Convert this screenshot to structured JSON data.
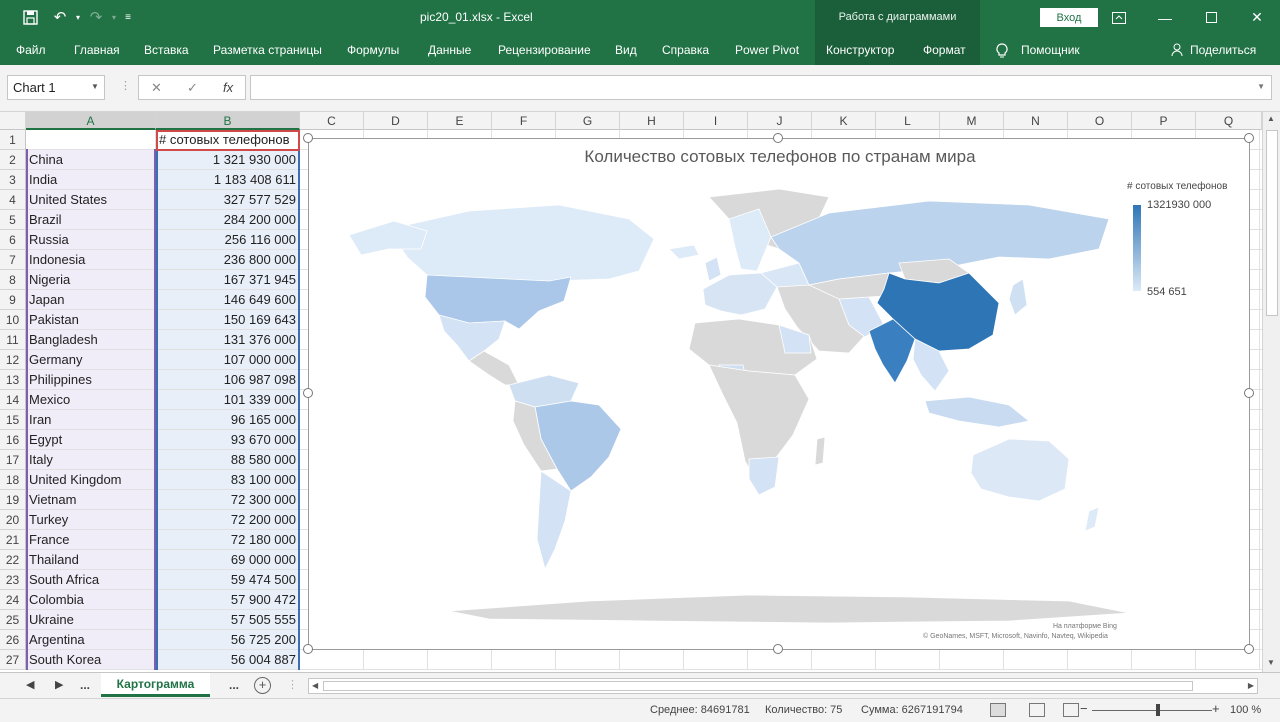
{
  "titlebar": {
    "title": "pic20_01.xlsx  -  Excel",
    "context_group": "Работа с диаграммами",
    "signin": "Вход"
  },
  "ribbon_tabs": [
    "Файл",
    "Главная",
    "Вставка",
    "Разметка страницы",
    "Формулы",
    "Данные",
    "Рецензирование",
    "Вид",
    "Справка",
    "Power Pivot",
    "Конструктор",
    "Формат",
    "Помощник",
    "Поделиться"
  ],
  "formula_bar": {
    "namebox": "Chart 1",
    "fx": "fx",
    "cancel": "✕",
    "enter": "✓"
  },
  "columns": [
    "A",
    "B",
    "C",
    "D",
    "E",
    "F",
    "G",
    "H",
    "I",
    "J",
    "K",
    "L",
    "M",
    "N",
    "O",
    "P",
    "Q"
  ],
  "sheet": {
    "header_b1": "# сотовых телефонов",
    "rows": [
      {
        "num": "1",
        "country": "",
        "value": ""
      },
      {
        "num": "2",
        "country": "China",
        "value": "1 321 930 000"
      },
      {
        "num": "3",
        "country": "India",
        "value": "1 183 408 611"
      },
      {
        "num": "4",
        "country": "United States",
        "value": "327 577 529"
      },
      {
        "num": "5",
        "country": "Brazil",
        "value": "284 200 000"
      },
      {
        "num": "6",
        "country": "Russia",
        "value": "256 116 000"
      },
      {
        "num": "7",
        "country": "Indonesia",
        "value": "236 800 000"
      },
      {
        "num": "8",
        "country": "Nigeria",
        "value": "167 371 945"
      },
      {
        "num": "9",
        "country": "Japan",
        "value": "146 649 600"
      },
      {
        "num": "10",
        "country": "Pakistan",
        "value": "150 169 643"
      },
      {
        "num": "11",
        "country": "Bangladesh",
        "value": "131 376 000"
      },
      {
        "num": "12",
        "country": "Germany",
        "value": "107 000 000"
      },
      {
        "num": "13",
        "country": "Philippines",
        "value": "106 987 098"
      },
      {
        "num": "14",
        "country": "Mexico",
        "value": "101 339 000"
      },
      {
        "num": "15",
        "country": "Iran",
        "value": "96 165 000"
      },
      {
        "num": "16",
        "country": "Egypt",
        "value": "93 670 000"
      },
      {
        "num": "17",
        "country": "Italy",
        "value": "88 580 000"
      },
      {
        "num": "18",
        "country": "United Kingdom",
        "value": "83 100 000"
      },
      {
        "num": "19",
        "country": "Vietnam",
        "value": "72 300 000"
      },
      {
        "num": "20",
        "country": "Turkey",
        "value": "72 200 000"
      },
      {
        "num": "21",
        "country": "France",
        "value": "72 180 000"
      },
      {
        "num": "22",
        "country": "Thailand",
        "value": "69 000 000"
      },
      {
        "num": "23",
        "country": "South Africa",
        "value": "59 474 500"
      },
      {
        "num": "24",
        "country": "Colombia",
        "value": "57 900 472"
      },
      {
        "num": "25",
        "country": "Ukraine",
        "value": "57 505 555"
      },
      {
        "num": "26",
        "country": "Argentina",
        "value": "56 725 200"
      },
      {
        "num": "27",
        "country": "South Korea",
        "value": "56 004 887"
      }
    ]
  },
  "chart": {
    "title": "Количество сотовых телефонов по странам мира",
    "legend_title": "# сотовых телефонов",
    "legend_max": "1321930 000",
    "legend_min": "554 651",
    "credit_bing": "На платформе Bing",
    "credit_sources": "© GeoNames, MSFT, Microsoft, Navinfo, Navteq, Wikipedia",
    "colors": {
      "max": "#2e75b6",
      "min": "#ddeaf7",
      "nodata": "#d9d9d9"
    }
  },
  "sheet_tabs": {
    "active": "Картограмма",
    "ellipsis": "..."
  },
  "status": {
    "average": "Среднее: 84691781",
    "count": "Количество: 75",
    "sum": "Сумма: 6267191794",
    "zoom": "100 %"
  }
}
